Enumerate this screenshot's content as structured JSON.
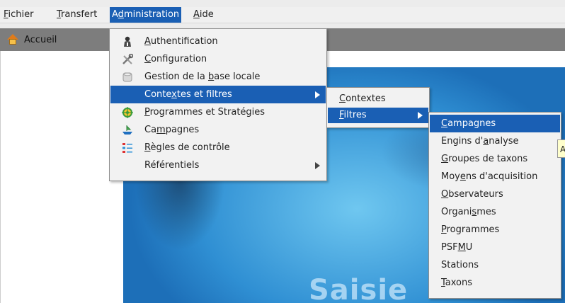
{
  "menubar": {
    "items": [
      {
        "mn": "F",
        "rest": "ichier"
      },
      {
        "mn": "T",
        "rest": "ransfert"
      },
      {
        "pre": "A",
        "mn": "d",
        "rest": "ministration"
      },
      {
        "mn": "A",
        "rest": "ide"
      }
    ]
  },
  "toolbar": {
    "home_label": "Accueil"
  },
  "admin_menu": {
    "items": [
      {
        "icon": "user-icon",
        "mn": "A",
        "rest": "uthentification"
      },
      {
        "icon": "tools-icon",
        "mn": "C",
        "rest": "onfiguration"
      },
      {
        "icon": "database-icon",
        "pre": "Gestion de la ",
        "mn": "b",
        "rest": "ase locale"
      },
      {
        "icon": "",
        "pre": "Conte",
        "mn": "x",
        "rest": "tes et filtres"
      },
      {
        "icon": "target-icon",
        "mn": "P",
        "rest": "rogrammes et Stratégies"
      },
      {
        "icon": "ship-icon",
        "pre": "Ca",
        "mn": "m",
        "rest": "pagnes"
      },
      {
        "icon": "checklist-icon",
        "mn": "R",
        "rest": "ègles de contrôle"
      },
      {
        "icon": "",
        "pre": "Référentiels"
      }
    ]
  },
  "context_menu": {
    "items": [
      {
        "mn": "C",
        "rest": "ontextes"
      },
      {
        "mn": "F",
        "rest": "iltres"
      }
    ]
  },
  "filters_menu": {
    "items": [
      {
        "mn": "C",
        "rest": "ampagnes"
      },
      {
        "pre": "Engins d'",
        "mn": "a",
        "rest": "nalyse"
      },
      {
        "mn": "G",
        "rest": "roupes de taxons"
      },
      {
        "pre": "Moy",
        "mn": "e",
        "rest": "ns d'acquisition"
      },
      {
        "mn": "O",
        "rest": "bservateurs"
      },
      {
        "pre": "Organi",
        "mn": "s",
        "rest": "mes"
      },
      {
        "mn": "P",
        "rest": "rogrammes"
      },
      {
        "pre": "PSF",
        "mn": "M",
        "rest": "U"
      },
      {
        "pre": "Stations"
      },
      {
        "mn": "T",
        "rest": "axons"
      }
    ]
  },
  "tooltip": {
    "text": "A"
  },
  "splash": {
    "text": "Saisie"
  },
  "colors": {
    "selection": "#1a5fb4",
    "toolbar": "#7d7d7d"
  }
}
